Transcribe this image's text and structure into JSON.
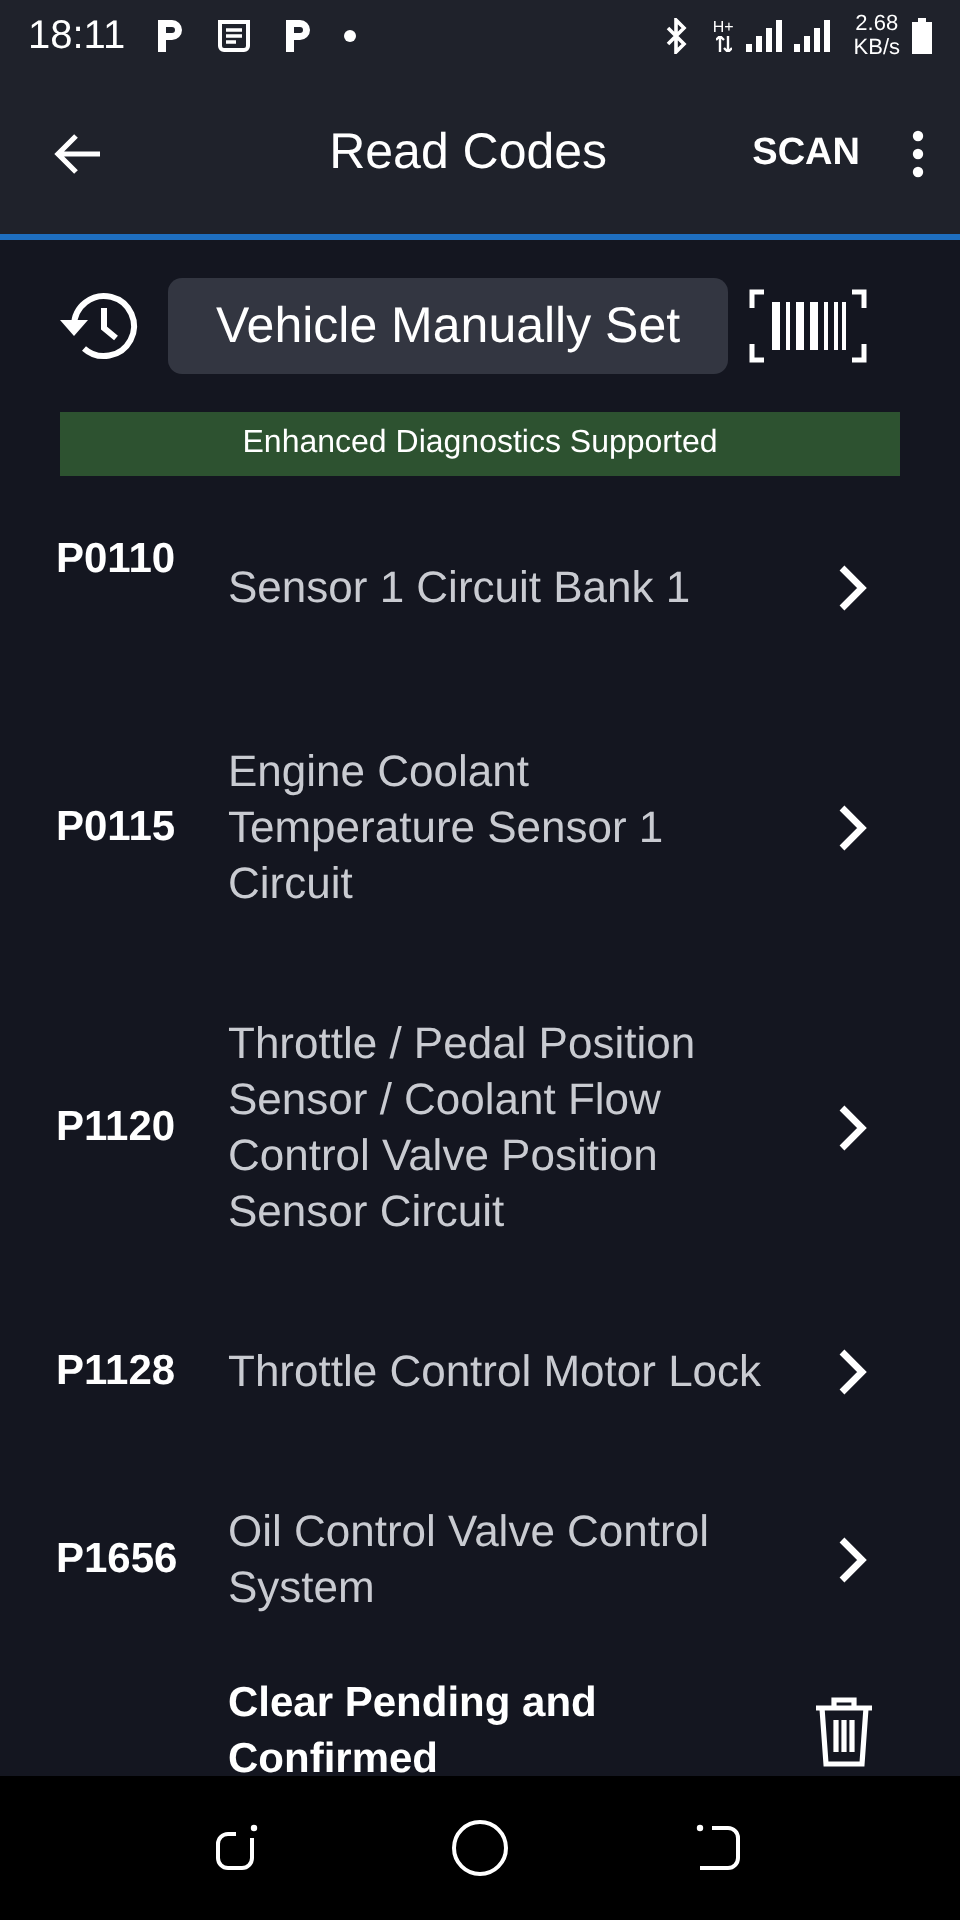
{
  "status_bar": {
    "time": "18:11",
    "network": "H+",
    "speed_value": "2.68",
    "speed_unit": "KB/s"
  },
  "app_bar": {
    "title": "Read Codes",
    "action": "SCAN"
  },
  "vehicle": {
    "label": "Vehicle Manually Set"
  },
  "banner": {
    "text": "Enhanced Diagnostics Supported"
  },
  "codes": [
    {
      "code": "P0110",
      "description": "Sensor 1 Circuit Bank 1"
    },
    {
      "code": "P0115",
      "description": "Engine Coolant Temperature Sensor 1 Circuit"
    },
    {
      "code": "P1120",
      "description": "Throttle / Pedal Position Sensor / Coolant Flow Control Valve Position Sensor Circuit"
    },
    {
      "code": "P1128",
      "description": "Throttle Control Motor Lock"
    },
    {
      "code": "P1656",
      "description": "Oil Control Valve Control System"
    }
  ],
  "clear_action": {
    "label": "Clear Pending and Confirmed"
  }
}
